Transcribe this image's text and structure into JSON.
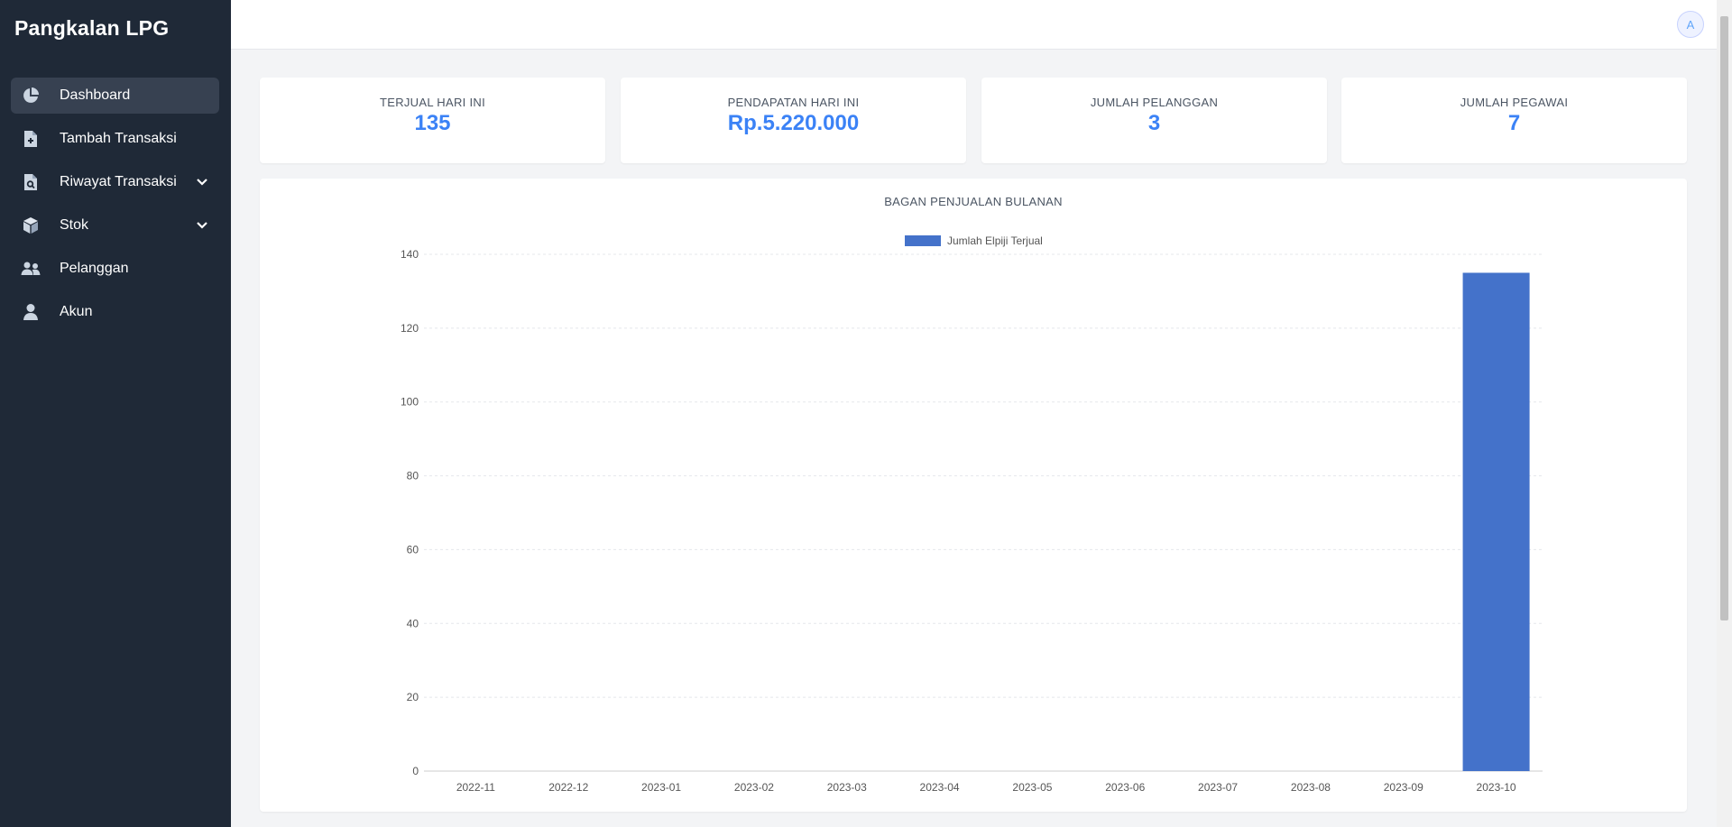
{
  "app": {
    "brand": "Pangkalan LPG"
  },
  "sidebar": {
    "items": [
      {
        "label": "Dashboard",
        "icon": "pie-chart-icon",
        "active": true
      },
      {
        "label": "Tambah Transaksi",
        "icon": "file-plus-icon"
      },
      {
        "label": "Riwayat Transaksi",
        "icon": "file-search-icon",
        "expandable": true
      },
      {
        "label": "Stok",
        "icon": "box-icon",
        "expandable": true
      },
      {
        "label": "Pelanggan",
        "icon": "users-icon"
      },
      {
        "label": "Akun",
        "icon": "user-icon"
      }
    ]
  },
  "header": {
    "avatar_initial": "A"
  },
  "stats": [
    {
      "label": "TERJUAL HARI INI",
      "value": "135"
    },
    {
      "label": "PENDAPATAN HARI INI",
      "value": "Rp.5.220.000"
    },
    {
      "label": "JUMLAH PELANGGAN",
      "value": "3"
    },
    {
      "label": "JUMLAH PEGAWAI",
      "value": "7"
    }
  ],
  "colors": {
    "accent": "#3b82f6",
    "bar": "#4472ca",
    "sidebar": "#1f2937"
  },
  "chart_data": {
    "type": "bar",
    "title": "BAGAN PENJUALAN BULANAN",
    "categories": [
      "2022-11",
      "2022-12",
      "2023-01",
      "2023-02",
      "2023-03",
      "2023-04",
      "2023-05",
      "2023-06",
      "2023-07",
      "2023-08",
      "2023-09",
      "2023-10"
    ],
    "series": [
      {
        "name": "Jumlah Elpiji Terjual",
        "values": [
          0,
          0,
          0,
          0,
          0,
          0,
          0,
          0,
          0,
          0,
          0,
          135
        ]
      }
    ],
    "y_ticks": [
      0,
      20,
      40,
      60,
      80,
      100,
      120,
      140
    ],
    "ylim": [
      0,
      140
    ],
    "grid": true,
    "legend_position": "top"
  }
}
